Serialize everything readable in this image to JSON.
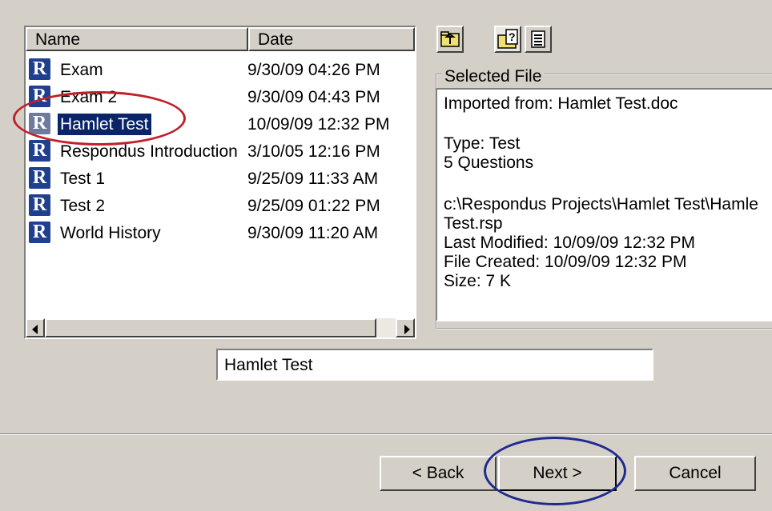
{
  "list": {
    "columns": [
      "Name",
      "Date"
    ],
    "rows": [
      {
        "name": "Exam",
        "date": "9/30/09  04:26 PM"
      },
      {
        "name": "Exam 2",
        "date": "9/30/09  04:43 PM"
      },
      {
        "name": "Hamlet Test",
        "date": "10/09/09  12:32 PM",
        "selected": true
      },
      {
        "name": "Respondus Introduction",
        "date": "3/10/05  12:16 PM"
      },
      {
        "name": "Test 1",
        "date": "9/25/09  11:33 AM"
      },
      {
        "name": "Test 2",
        "date": "9/25/09  01:22 PM"
      },
      {
        "name": "World History",
        "date": "9/30/09  11:20 AM"
      }
    ],
    "icon": "R"
  },
  "toolbar": {
    "icons": [
      "up-folder-icon",
      "properties-icon",
      "details-view-icon"
    ]
  },
  "selected_file": {
    "label": "Selected File",
    "lines": [
      "Imported from: Hamlet Test.doc",
      "",
      "Type: Test",
      "5 Questions",
      "",
      "c:\\Respondus Projects\\Hamlet Test\\Hamle",
      "Test.rsp",
      "Last Modified: 10/09/09  12:32 PM",
      "File Created: 10/09/09  12:32 PM",
      "Size: 7 K"
    ]
  },
  "filename_value": "Hamlet Test",
  "buttons": {
    "back": "< Back",
    "next": "Next >",
    "cancel": "Cancel"
  },
  "colors": {
    "selection": "#0a246a",
    "annotation_red": "#c0202a",
    "annotation_blue": "#1f2a8f"
  }
}
